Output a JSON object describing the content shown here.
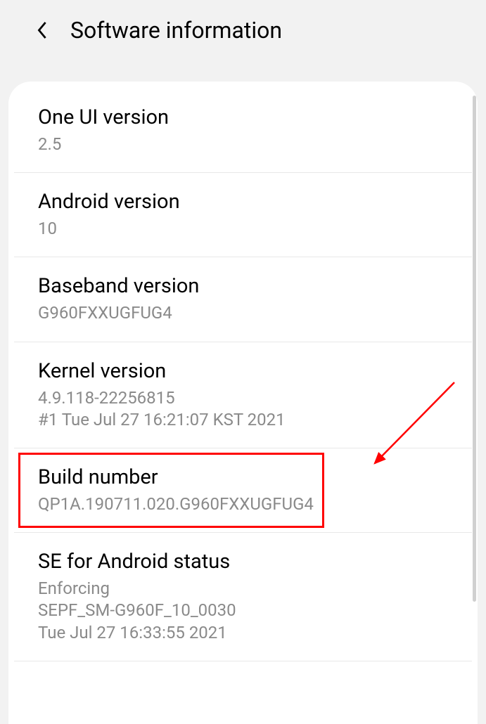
{
  "header": {
    "title": "Software information"
  },
  "items": [
    {
      "title": "One UI version",
      "values": [
        "2.5"
      ]
    },
    {
      "title": "Android version",
      "values": [
        "10"
      ]
    },
    {
      "title": "Baseband version",
      "values": [
        "G960FXXUGFUG4"
      ]
    },
    {
      "title": "Kernel version",
      "values": [
        "4.9.118-22256815",
        "#1 Tue Jul 27 16:21:07 KST 2021"
      ]
    },
    {
      "title": "Build number",
      "values": [
        "QP1A.190711.020.G960FXXUGFUG4"
      ]
    },
    {
      "title": "SE for Android status",
      "values": [
        "Enforcing",
        "SEPF_SM-G960F_10_0030",
        "Tue Jul 27 16:33:55 2021"
      ]
    }
  ],
  "annotations": {
    "highlight_index": 4,
    "arrow_color": "#ff0000"
  }
}
